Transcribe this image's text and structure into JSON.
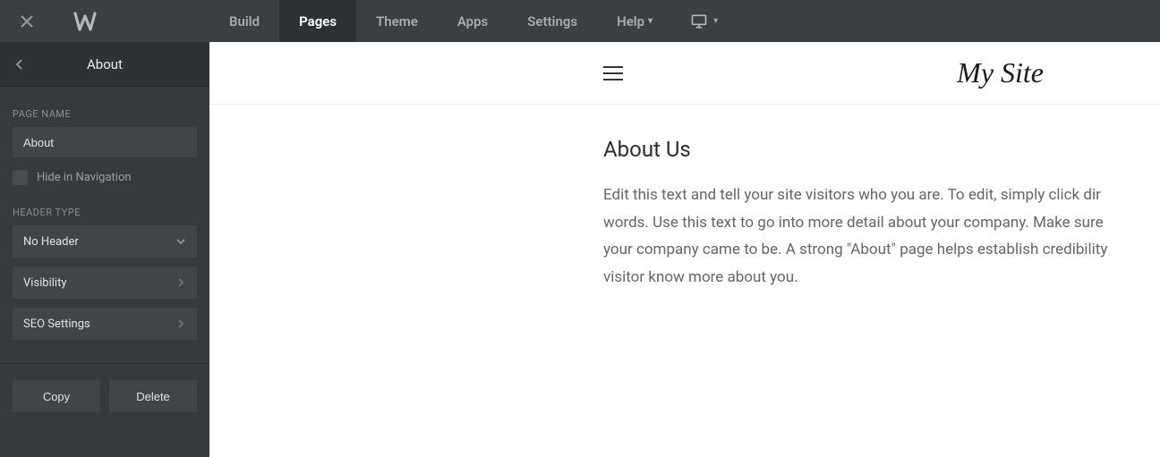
{
  "topbar": {
    "nav": {
      "build": "Build",
      "pages": "Pages",
      "theme": "Theme",
      "apps": "Apps",
      "settings": "Settings",
      "help": "Help"
    }
  },
  "sidebar": {
    "title": "About",
    "sections": {
      "page_name_label": "PAGE NAME",
      "page_name_value": "About",
      "hide_nav_label": "Hide in Navigation",
      "header_type_label": "HEADER TYPE",
      "header_type_value": "No Header",
      "visibility_label": "Visibility",
      "seo_label": "SEO Settings"
    },
    "footer": {
      "copy": "Copy",
      "delete": "Delete"
    }
  },
  "preview": {
    "site_title": "My Site",
    "heading": "About Us",
    "body_line1": "Edit this text and tell your site visitors who you are. To edit, simply click dir",
    "body_line2": "words. Use this text to go into more detail about your company. Make sure",
    "body_line3": "your company came to be. A strong \"About\" page helps establish credibility",
    "body_line4": "visitor know more about you."
  }
}
